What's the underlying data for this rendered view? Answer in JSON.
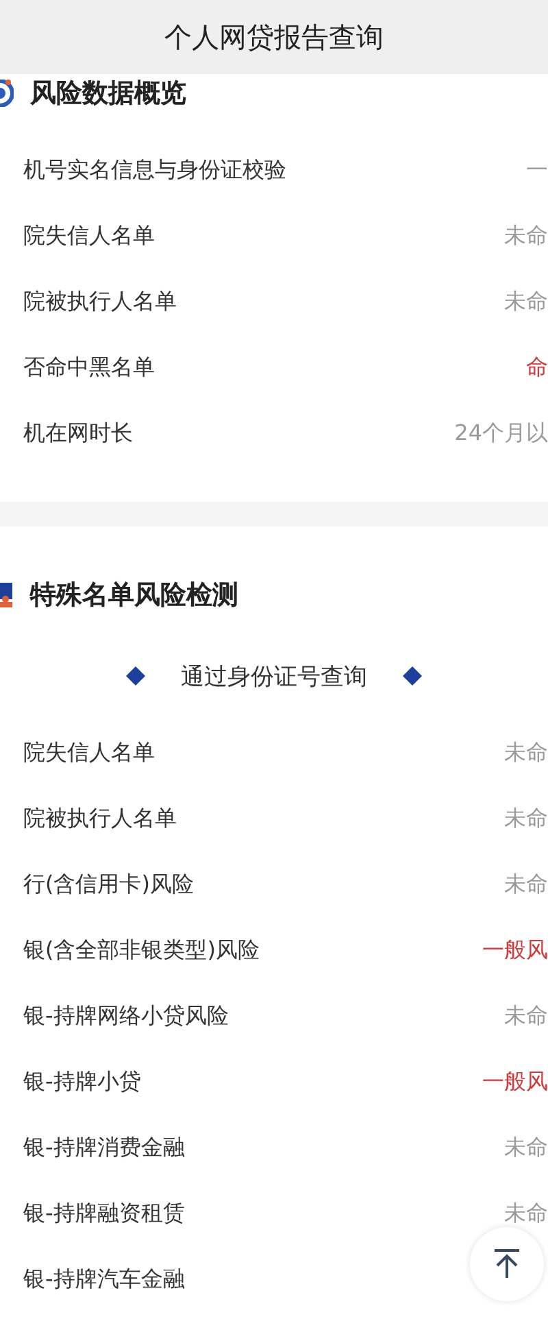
{
  "header": {
    "title": "个人网贷报告查询"
  },
  "sections": [
    {
      "title": "风险数据概览",
      "kind": "overview",
      "rows": [
        {
          "label": "机号实名信息与身份证校验",
          "value": "一",
          "alert": false
        },
        {
          "label": "院失信人名单",
          "value": "未命",
          "alert": false
        },
        {
          "label": "院被执行人名单",
          "value": "未命",
          "alert": false
        },
        {
          "label": "否命中黑名单",
          "value": "命",
          "alert": true
        },
        {
          "label": "机在网时长",
          "value": "24个月以",
          "alert": false
        }
      ]
    },
    {
      "title": "特殊名单风险检测",
      "kind": "special",
      "subtitle": "通过身份证号查询",
      "rows": [
        {
          "label": "院失信人名单",
          "value": "未命",
          "alert": false
        },
        {
          "label": "院被执行人名单",
          "value": "未命",
          "alert": false
        },
        {
          "label": "行(含信用卡)风险",
          "value": "未命",
          "alert": false
        },
        {
          "label": "银(含全部非银类型)风险",
          "value": "一般风",
          "alert": true
        },
        {
          "label": "银-持牌网络小贷风险",
          "value": "未命",
          "alert": false
        },
        {
          "label": "银-持牌小贷",
          "value": "一般风",
          "alert": true
        },
        {
          "label": "银-持牌消费金融",
          "value": "未命",
          "alert": false
        },
        {
          "label": "银-持牌融资租赁",
          "value": "未命",
          "alert": false
        },
        {
          "label": "银-持牌汽车金融"
        }
      ]
    }
  ]
}
